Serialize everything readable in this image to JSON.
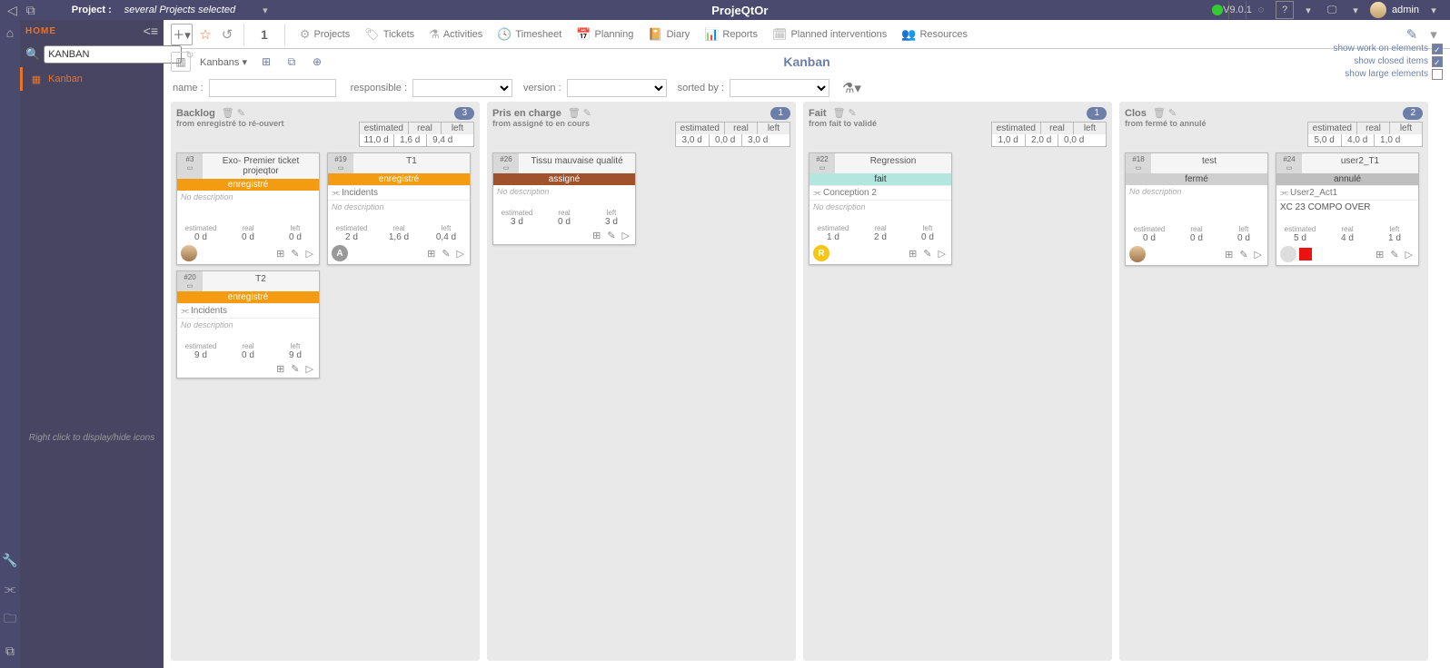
{
  "topbar": {
    "project_label": "Project :",
    "project_name": "several Projects selected",
    "app_name": "ProjeQtOr",
    "version": "V9.0.1",
    "user": "admin"
  },
  "sidebar": {
    "home": "HOME",
    "search_value": "KANBAN",
    "nav_kanban": "Kanban",
    "footer": "Right click to display/hide icons"
  },
  "toolbar": {
    "nav_number": "1",
    "links": [
      "Projects",
      "Tickets",
      "Activities",
      "Timesheet",
      "Planning",
      "Diary",
      "Reports",
      "Planned interventions",
      "Resources"
    ]
  },
  "subbar": {
    "kanbans": "Kanbans",
    "page_title": "Kanban",
    "opt_work": "show work on elements",
    "opt_closed": "show closed items",
    "opt_large": "show large elements"
  },
  "filters": {
    "name": "name :",
    "responsible": "responsible :",
    "version": "version :",
    "sorted": "sorted by :"
  },
  "columns": [
    {
      "title": "Backlog",
      "sub": "from enregistré to ré-ouvert",
      "count": "3",
      "sum_h": [
        "estimated",
        "real",
        "left"
      ],
      "sum_v": [
        "11,0 d",
        "1,6 d",
        "9,4 d"
      ],
      "cards": [
        [
          {
            "id": "#3",
            "title": "Exo- Premier ticket projeqtor",
            "status": "enregistré",
            "st": "st-orange",
            "desc": "No description",
            "metrics": [
              "0 d",
              "0 d",
              "0 d"
            ],
            "foot_avatar": "photo"
          },
          {
            "id": "#19",
            "title": "T1",
            "status": "enregistré",
            "st": "st-orange",
            "link": "Incidents",
            "desc": "No description",
            "metrics": [
              "2 d",
              "1,6 d",
              "0,4 d"
            ],
            "foot_avatar": "a",
            "foot_label": "A"
          }
        ],
        [
          {
            "id": "#20",
            "title": "T2",
            "status": "enregistré",
            "st": "st-orange",
            "link": "Incidents",
            "desc": "No description",
            "metrics": [
              "9 d",
              "0 d",
              "9 d"
            ]
          }
        ]
      ]
    },
    {
      "title": "Pris en charge",
      "sub": "from assigné to en cours",
      "count": "1",
      "sum_h": [
        "estimated",
        "real",
        "left"
      ],
      "sum_v": [
        "3,0 d",
        "0,0 d",
        "3,0 d"
      ],
      "cards": [
        [
          {
            "id": "#26",
            "title": "Tissu mauvaise qualité",
            "status": "assigné",
            "st": "st-brown",
            "desc": "No description",
            "metrics": [
              "3 d",
              "0 d",
              "3 d"
            ]
          }
        ]
      ]
    },
    {
      "title": "Fait",
      "sub": "from fait to validé",
      "count": "1",
      "sum_h": [
        "estimated",
        "real",
        "left"
      ],
      "sum_v": [
        "1,0 d",
        "2,0 d",
        "0,0 d"
      ],
      "cards": [
        [
          {
            "id": "#22",
            "title": "Regression",
            "status": "fait",
            "st": "st-teal",
            "link": "Conception 2",
            "desc": "No description",
            "metrics": [
              "1 d",
              "2 d",
              "0 d"
            ],
            "foot_avatar": "r",
            "foot_label": "R"
          }
        ]
      ]
    },
    {
      "title": "Clos",
      "sub": "from fermé to annulé",
      "count": "2",
      "sum_h": [
        "estimated",
        "real",
        "left"
      ],
      "sum_v": [
        "5,0 d",
        "4,0 d",
        "1,0 d"
      ],
      "cards": [
        [
          {
            "id": "#18",
            "title": "test",
            "status": "fermé",
            "st": "st-grey",
            "desc": "No description",
            "metrics": [
              "0 d",
              "0 d",
              "0 d"
            ],
            "foot_avatar": "photo"
          },
          {
            "id": "#24",
            "title": "user2_T1",
            "status": "annulé",
            "st": "st-grey2",
            "link": "User2_Act1",
            "body": "XC 23 COMPO OVER",
            "metrics": [
              "5 d",
              "4 d",
              "1 d"
            ],
            "foot_red": true
          }
        ]
      ]
    }
  ],
  "labels": {
    "estimated": "estimated",
    "real": "real",
    "left": "left"
  }
}
